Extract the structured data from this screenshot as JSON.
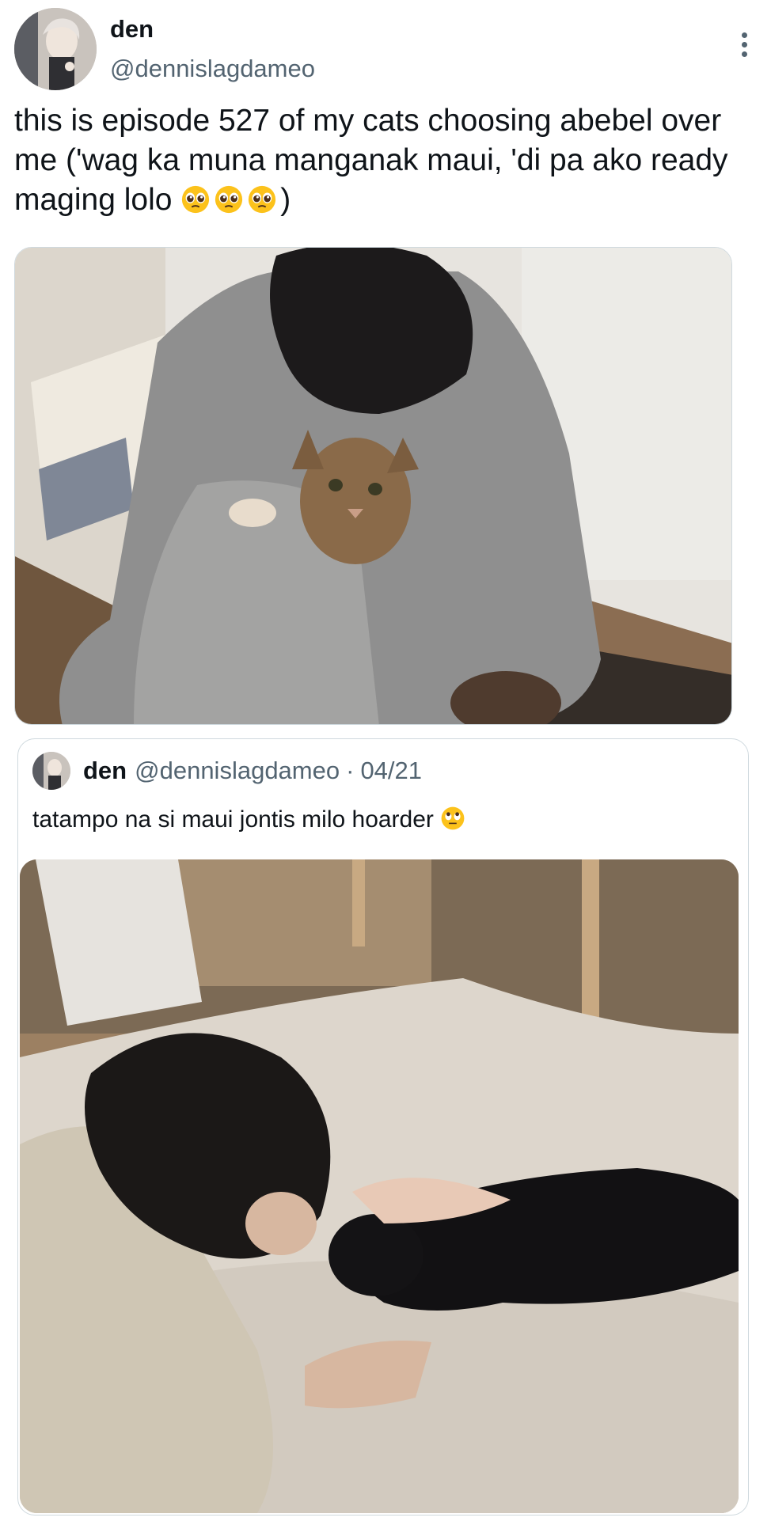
{
  "tweet": {
    "display_name": "den",
    "handle": "@dennislagdameo",
    "text": "this is episode 527 of my cats choosing abebel over me ('wag ka muna manganak maui, 'di pa ako ready maging lolo ",
    "text_emoji": "pleading-face",
    "text_end": ")",
    "more_icon": "more-vertical-icon"
  },
  "quoted_tweet": {
    "display_name": "den",
    "handle": "@dennislagdameo",
    "separator": "·",
    "date": "04/21",
    "text": "tatampo na si maui jontis milo hoarder ",
    "text_emoji": "eye-roll-face"
  },
  "colors": {
    "text": "#0f1419",
    "secondary": "#536471",
    "border": "#cfd9de"
  }
}
